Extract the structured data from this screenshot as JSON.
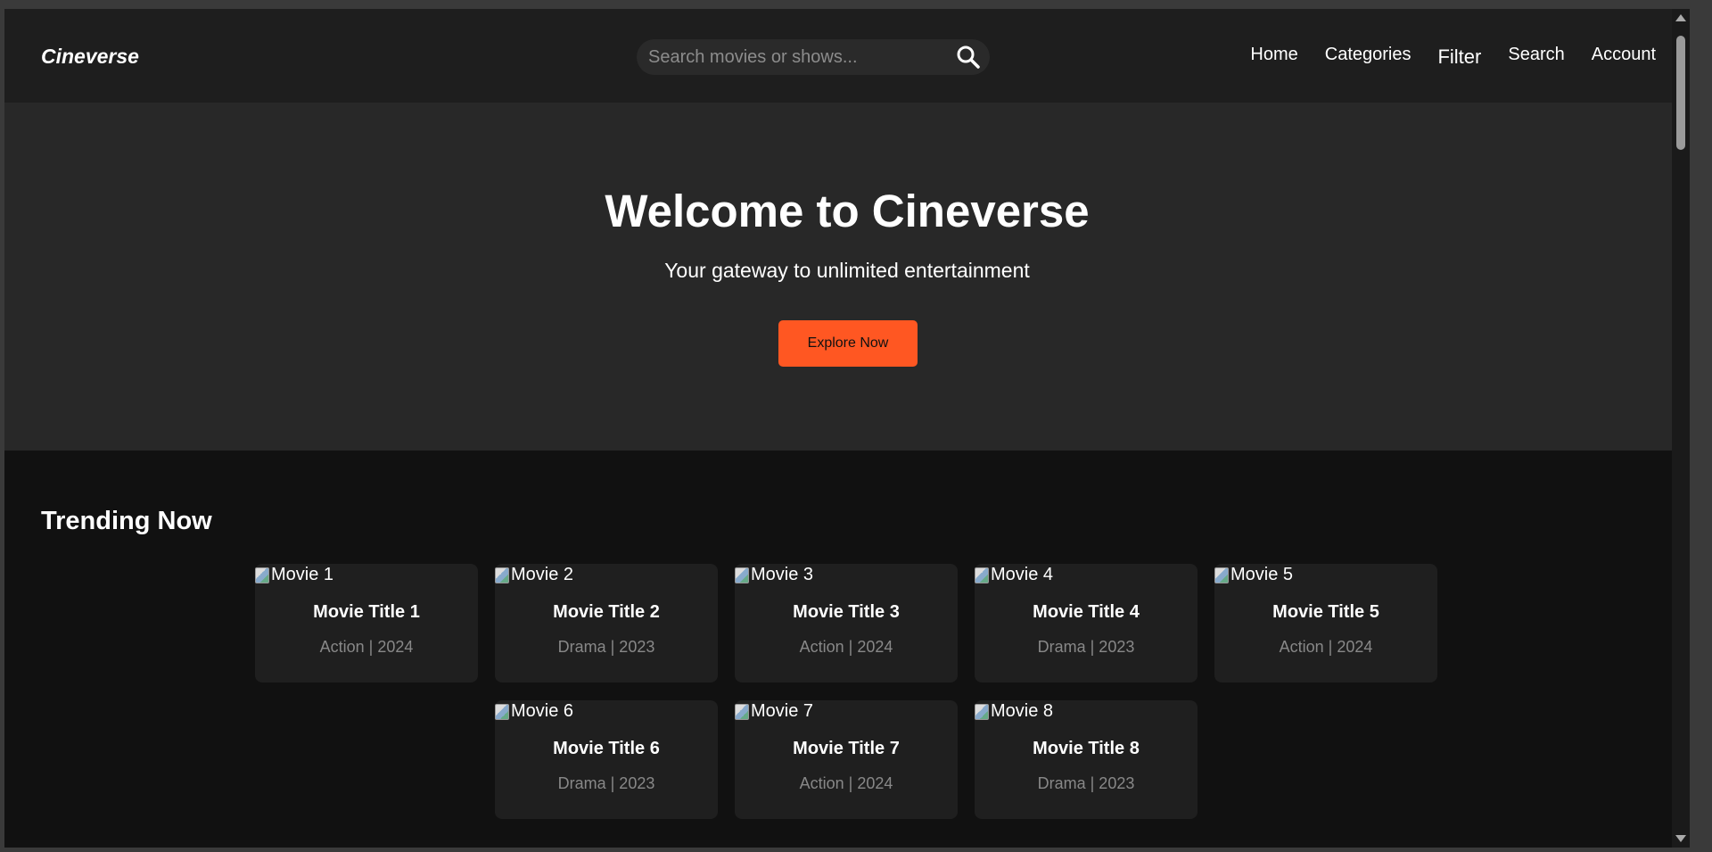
{
  "header": {
    "logo": "Cineverse",
    "search_placeholder": "Search movies or shows...",
    "nav": [
      "Home",
      "Categories",
      "Filter",
      "Search",
      "Account"
    ]
  },
  "hero": {
    "title": "Welcome to Cineverse",
    "subtitle": "Your gateway to unlimited entertainment",
    "cta": "Explore Now"
  },
  "trending": {
    "heading": "Trending Now",
    "movies": [
      {
        "alt": "Movie 1",
        "title": "Movie Title 1",
        "meta": "Action | 2024"
      },
      {
        "alt": "Movie 2",
        "title": "Movie Title 2",
        "meta": "Drama | 2023"
      },
      {
        "alt": "Movie 3",
        "title": "Movie Title 3",
        "meta": "Action | 2024"
      },
      {
        "alt": "Movie 4",
        "title": "Movie Title 4",
        "meta": "Drama | 2023"
      },
      {
        "alt": "Movie 5",
        "title": "Movie Title 5",
        "meta": "Action | 2024"
      },
      {
        "alt": "Movie 6",
        "title": "Movie Title 6",
        "meta": "Drama | 2023"
      },
      {
        "alt": "Movie 7",
        "title": "Movie Title 7",
        "meta": "Action | 2024"
      },
      {
        "alt": "Movie 8",
        "title": "Movie Title 8",
        "meta": "Drama | 2023"
      }
    ]
  },
  "colors": {
    "accent": "#ff5722",
    "header_bg": "#1e1e1e",
    "hero_bg": "#282828",
    "body_bg": "#111111",
    "card_bg": "#1f1f1f"
  }
}
